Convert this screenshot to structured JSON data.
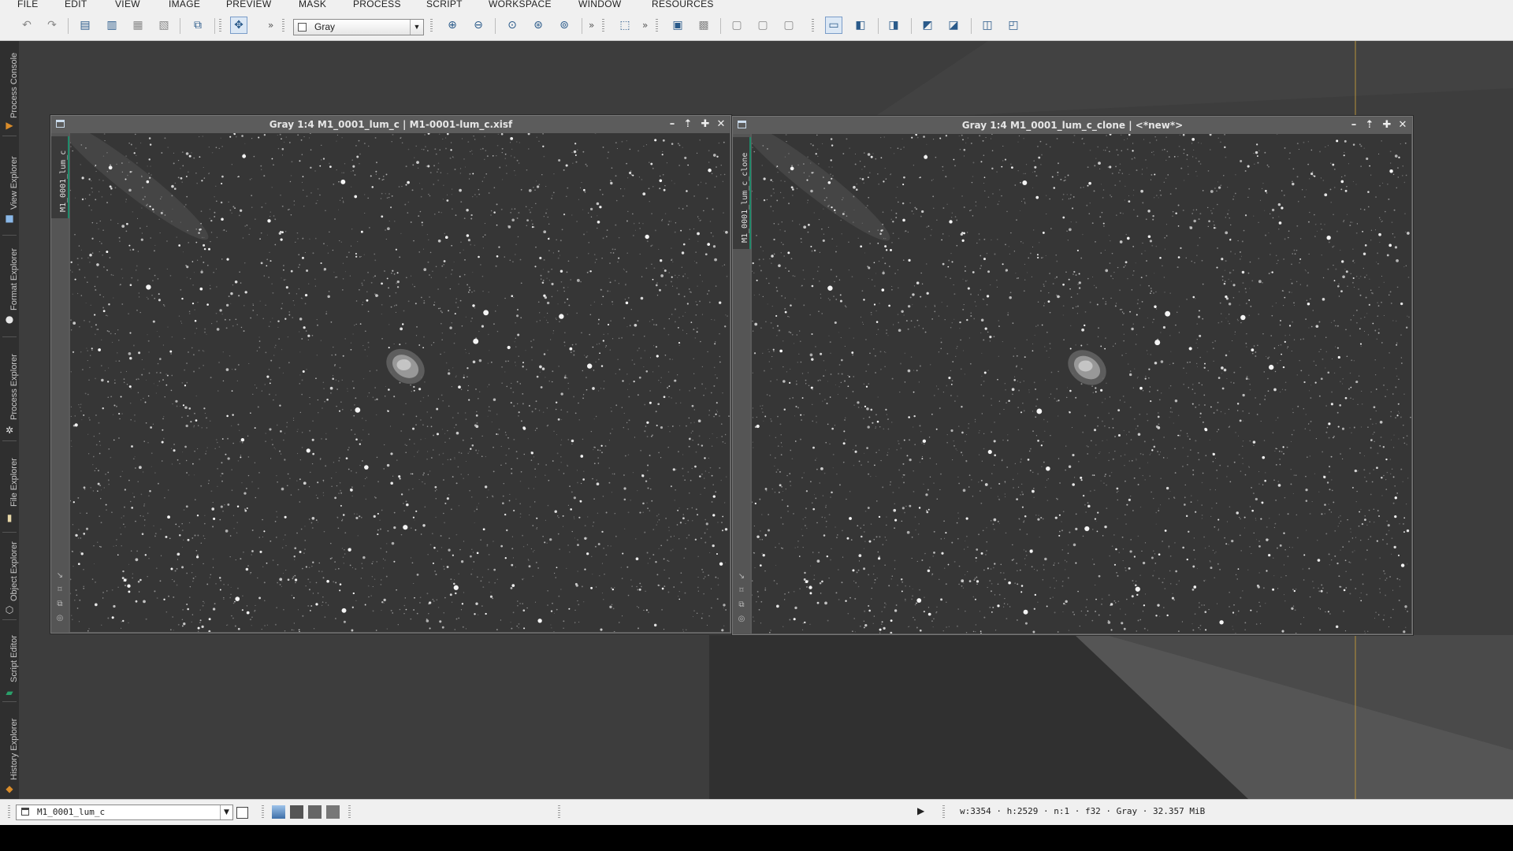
{
  "menu": [
    "FILE",
    "EDIT",
    "VIEW",
    "IMAGE",
    "PREVIEW",
    "MASK",
    "PROCESS",
    "SCRIPT",
    "WORKSPACE",
    "WINDOW",
    "RESOURCES"
  ],
  "toolbar": {
    "view_select_value": "Gray",
    "icons": [
      "undo-icon",
      "redo-icon",
      "new-image-icon",
      "open-icon",
      "save-icon",
      "save-as-icon",
      "new-preview-icon",
      "pan-mode-icon",
      "zoom-in-icon",
      "zoom-out-icon",
      "zoom-1-1-icon",
      "zoom-fit-icon",
      "zoom-custom-icon",
      "mask-icon",
      "preview-icon",
      "window-icon",
      "screen-stretch-icon"
    ]
  },
  "left_dock": {
    "tabs": [
      "Process Console",
      "View Explorer",
      "Format Explorer",
      "Process Explorer",
      "File Explorer",
      "Object Explorer",
      "Script Editor",
      "History Explorer"
    ]
  },
  "windows": [
    {
      "title": "Gray 1:4 M1_0001_lum_c | M1-0001-lum_c.xisf",
      "view_id": "M1_0001_lum_c"
    },
    {
      "title": "Gray 1:4 M1_0001_lum_c_clone | <*new*>",
      "view_id": "M1_0001_lum_c_clone"
    }
  ],
  "statusbar": {
    "view_list_value": "M1_0001_lum_c",
    "image_info": "w:3354 · h:2529 · n:1 · f32 · Gray · 32.357 MiB"
  }
}
